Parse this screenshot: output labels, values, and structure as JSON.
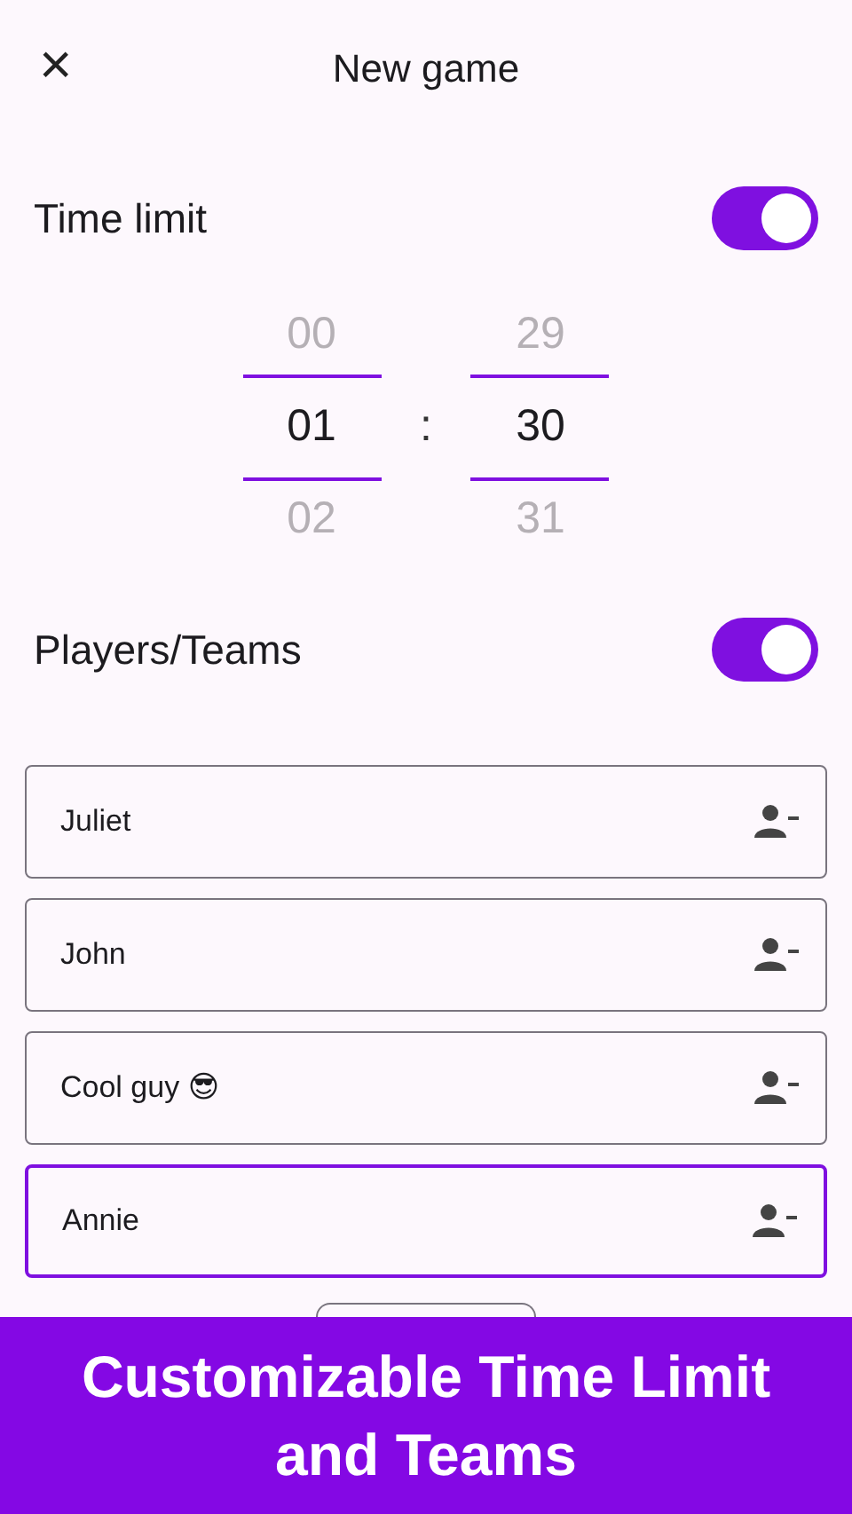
{
  "header": {
    "close": "×",
    "title": "New game"
  },
  "time_limit": {
    "label": "Time limit",
    "on": true
  },
  "picker": {
    "hours": [
      "00",
      "01",
      "02"
    ],
    "separator": ":",
    "minutes": [
      "29",
      "30",
      "31"
    ]
  },
  "players_toggle": {
    "label": "Players/Teams",
    "on": true
  },
  "players": [
    {
      "value": "Juliet",
      "focused": false
    },
    {
      "value": "John",
      "focused": false
    },
    {
      "value": "Cool guy 😎",
      "focused": false
    },
    {
      "value": "Annie",
      "focused": true
    }
  ],
  "banner": {
    "lines": [
      "Customizable Time Limit",
      "and Teams"
    ]
  }
}
